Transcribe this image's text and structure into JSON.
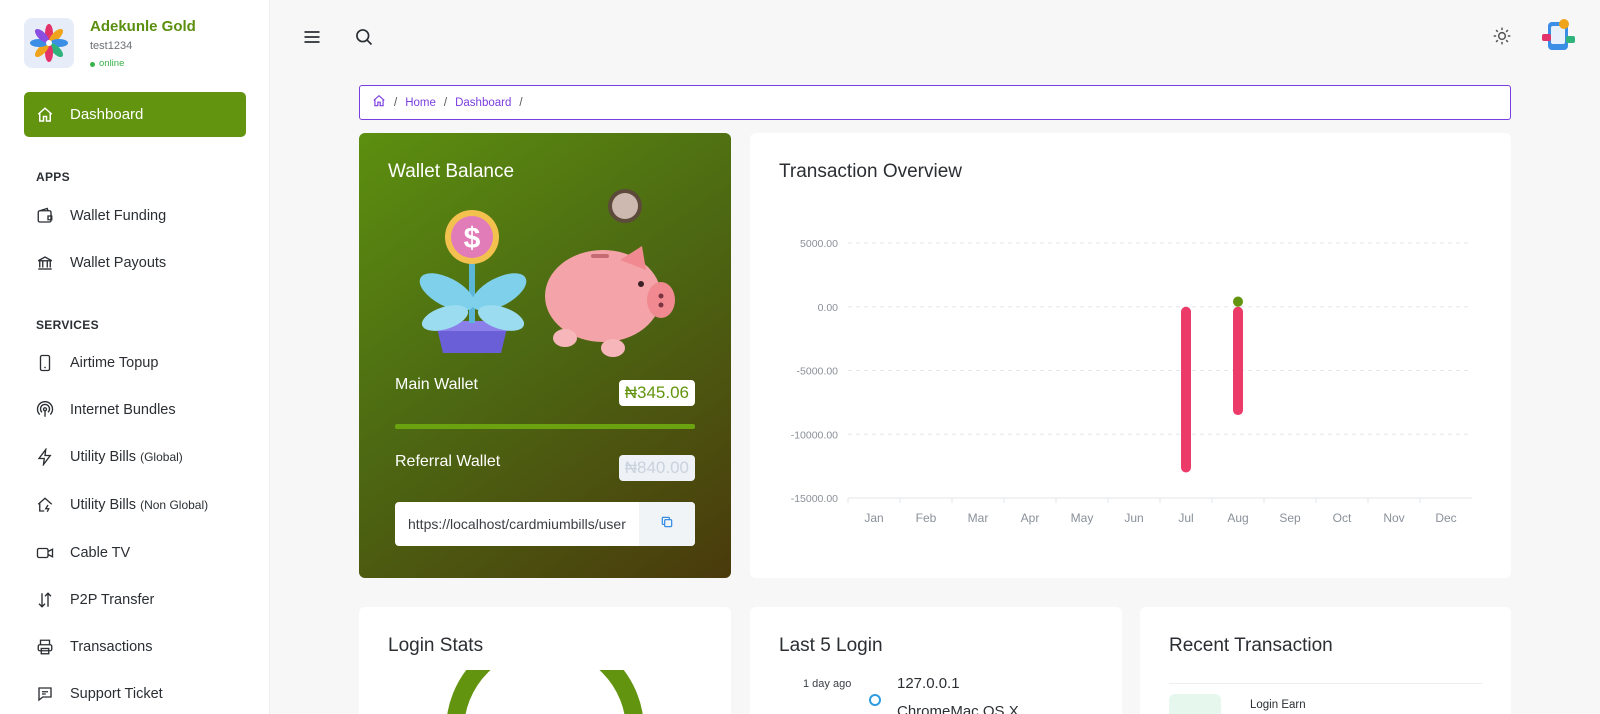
{
  "profile": {
    "name": "Adekunle Gold",
    "username": "test1234",
    "status": "online"
  },
  "sidebar": {
    "dashboard": "Dashboard",
    "apps_title": "APPS",
    "apps": [
      {
        "label": "Wallet Funding",
        "icon": "wallet-icon"
      },
      {
        "label": "Wallet Payouts",
        "icon": "bank-icon"
      }
    ],
    "services_title": "SERVICES",
    "services": [
      {
        "label": "Airtime Topup",
        "sub": "",
        "icon": "phone-icon"
      },
      {
        "label": "Internet Bundles",
        "sub": "",
        "icon": "broadcast-icon"
      },
      {
        "label": "Utility Bills",
        "sub": "(Global)",
        "icon": "bolt-icon"
      },
      {
        "label": "Utility Bills",
        "sub": "(Non Global)",
        "icon": "home-bolt-icon"
      },
      {
        "label": "Cable TV",
        "sub": "",
        "icon": "video-icon"
      },
      {
        "label": "P2P Transfer",
        "sub": "",
        "icon": "transfer-arrows-icon"
      },
      {
        "label": "Transactions",
        "sub": "",
        "icon": "printer-icon"
      },
      {
        "label": "Support Ticket",
        "sub": "",
        "icon": "chat-icon"
      }
    ]
  },
  "breadcrumb": {
    "items": [
      "Home",
      "Dashboard"
    ]
  },
  "wallet": {
    "title": "Wallet Balance",
    "main_label": "Main Wallet",
    "main_amount": "₦345.06",
    "referral_label": "Referral Wallet",
    "referral_amount": "₦840.00",
    "referral_link": "https://localhost/cardmiumbills/user"
  },
  "overview": {
    "title": "Transaction Overview"
  },
  "chart_data": {
    "type": "bar",
    "categories": [
      "Jan",
      "Feb",
      "Mar",
      "Apr",
      "May",
      "Jun",
      "Jul",
      "Aug",
      "Sep",
      "Oct",
      "Nov",
      "Dec"
    ],
    "series": [
      {
        "values": [
          0,
          0,
          0,
          0,
          0,
          0,
          -13000,
          -8500,
          0,
          0,
          0,
          0
        ],
        "color": "#ec3b69"
      },
      {
        "values": [
          0,
          0,
          0,
          0,
          0,
          0,
          0,
          800,
          0,
          0,
          0,
          0
        ],
        "color": "#62940f"
      }
    ],
    "y_ticks": [
      "5000.00",
      "0.00",
      "-5000.00",
      "-10000.00",
      "-15000.00"
    ],
    "ylim": [
      -15000,
      5000
    ],
    "grid": true
  },
  "login_stats": {
    "title": "Login Stats"
  },
  "last_login": {
    "title": "Last 5 Login",
    "items": [
      {
        "time": "1 day ago",
        "ip": "127.0.0.1",
        "device": "ChromeMac OS X"
      }
    ]
  },
  "recent": {
    "title": "Recent Transaction",
    "items": [
      {
        "label": "Login Earn"
      }
    ]
  }
}
